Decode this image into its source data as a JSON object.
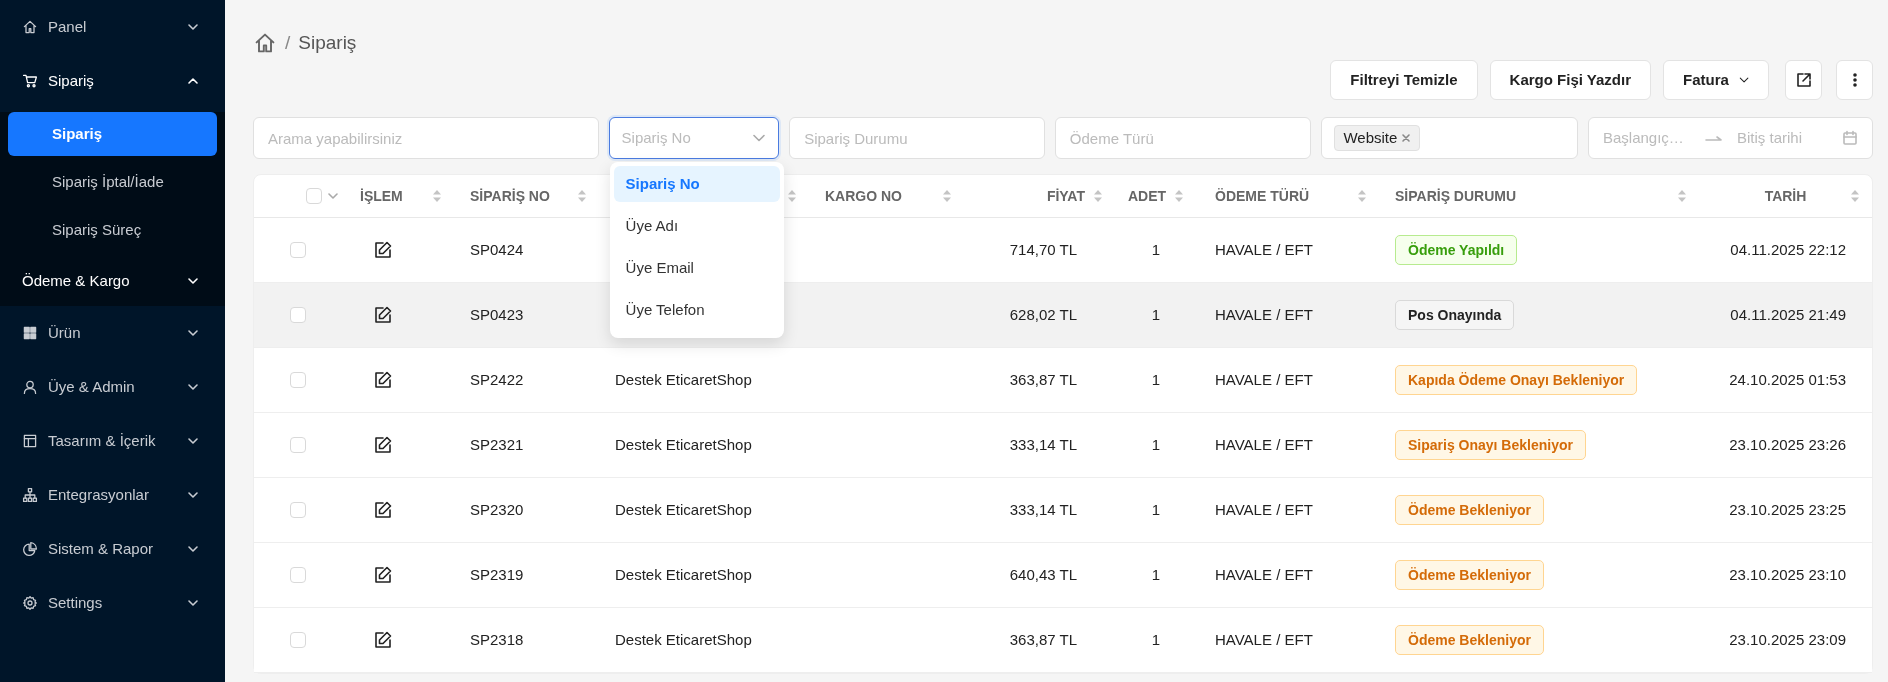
{
  "sidebar": {
    "items": [
      {
        "label": "Panel",
        "expanded": false,
        "selected": false
      },
      {
        "label": "Sipariş",
        "expanded": true,
        "selected": false,
        "children": [
          {
            "kind": "link",
            "label": "Sipariş",
            "selected": true
          },
          {
            "kind": "link",
            "label": "Sipariş İptal/İade",
            "selected": false
          },
          {
            "kind": "link",
            "label": "Sipariş Süreç",
            "selected": false
          },
          {
            "kind": "submenu",
            "label": "Ödeme & Kargo",
            "selected": false,
            "expanded": false
          }
        ]
      },
      {
        "label": "Ürün",
        "expanded": false,
        "selected": false
      },
      {
        "label": "Üye & Admin",
        "expanded": false,
        "selected": false
      },
      {
        "label": "Tasarım & İçerik",
        "expanded": false,
        "selected": false
      },
      {
        "label": "Entegrasyonlar",
        "expanded": false,
        "selected": false
      },
      {
        "label": "Sistem & Rapor",
        "expanded": false,
        "selected": false
      },
      {
        "label": "Settings",
        "expanded": false,
        "selected": false
      }
    ]
  },
  "breadcrumb": {
    "separator": "/",
    "current": "Sipariş"
  },
  "toolbar": {
    "buttons": [
      {
        "kind": "text",
        "label": "Filtreyi Temizle"
      },
      {
        "kind": "text",
        "label": "Kargo Fişi Yazdır"
      },
      {
        "kind": "dropdown",
        "label": "Fatura"
      },
      {
        "kind": "export"
      },
      {
        "kind": "more"
      }
    ]
  },
  "filters": {
    "search": {
      "placeholder": "Arama yapabilirsiniz"
    },
    "search_by": {
      "value": "Sipariş No",
      "open": true,
      "options": [
        {
          "label": "Sipariş No",
          "selected": true
        },
        {
          "label": "Üye Adı",
          "selected": false
        },
        {
          "label": "Üye Email",
          "selected": false
        },
        {
          "label": "Üye Telefon",
          "selected": false
        }
      ]
    },
    "order_status": {
      "placeholder": "Sipariş Durumu"
    },
    "payment_type": {
      "placeholder": "Ödeme Türü"
    },
    "channel": {
      "tags": [
        "Website"
      ]
    },
    "date_range": {
      "start_placeholder": "Başlangıç…",
      "end_placeholder": "Bitiş tarihi"
    }
  },
  "table": {
    "select_all": {
      "checked": false
    },
    "columns": [
      "İŞLEM",
      "SİPARİŞ NO",
      "",
      "KARGO NO",
      "FİYAT",
      "ADET",
      "ÖDEME TÜRÜ",
      "SİPARİŞ DURUMU",
      "TARİH"
    ],
    "rows": [
      {
        "checked": false,
        "highlighted": false,
        "order_no": "SP0424",
        "member": "",
        "cargo_no": "",
        "price": "714,70 TL",
        "quantity": "1",
        "payment": "HAVALE / EFT",
        "status": {
          "label": "Ödeme Yapıldı",
          "kind": "success"
        },
        "date": "04.11.2025 22:12"
      },
      {
        "checked": false,
        "highlighted": true,
        "order_no": "SP0423",
        "member": "",
        "cargo_no": "",
        "price": "628,02 TL",
        "quantity": "1",
        "payment": "HAVALE / EFT",
        "status": {
          "label": "Pos Onayında",
          "kind": "default"
        },
        "date": "04.11.2025 21:49"
      },
      {
        "checked": false,
        "highlighted": false,
        "order_no": "SP2422",
        "member": "Destek EticaretShop",
        "cargo_no": "",
        "price": "363,87 TL",
        "quantity": "1",
        "payment": "HAVALE / EFT",
        "status": {
          "label": "Kapıda Ödeme Onayı Bekleniyor",
          "kind": "warning"
        },
        "date": "24.10.2025 01:53"
      },
      {
        "checked": false,
        "highlighted": false,
        "order_no": "SP2321",
        "member": "Destek EticaretShop",
        "cargo_no": "",
        "price": "333,14 TL",
        "quantity": "1",
        "payment": "HAVALE / EFT",
        "status": {
          "label": "Sipariş Onayı Bekleniyor",
          "kind": "warning"
        },
        "date": "23.10.2025 23:26"
      },
      {
        "checked": false,
        "highlighted": false,
        "order_no": "SP2320",
        "member": "Destek EticaretShop",
        "cargo_no": "",
        "price": "333,14 TL",
        "quantity": "1",
        "payment": "HAVALE / EFT",
        "status": {
          "label": "Ödeme Bekleniyor",
          "kind": "warning"
        },
        "date": "23.10.2025 23:25"
      },
      {
        "checked": false,
        "highlighted": false,
        "order_no": "SP2319",
        "member": "Destek EticaretShop",
        "cargo_no": "",
        "price": "640,43 TL",
        "quantity": "1",
        "payment": "HAVALE / EFT",
        "status": {
          "label": "Ödeme Bekleniyor",
          "kind": "warning"
        },
        "date": "23.10.2025 23:10"
      },
      {
        "checked": false,
        "highlighted": false,
        "order_no": "SP2318",
        "member": "Destek EticaretShop",
        "cargo_no": "",
        "price": "363,87 TL",
        "quantity": "1",
        "payment": "HAVALE / EFT",
        "status": {
          "label": "Ödeme Bekleniyor",
          "kind": "warning"
        },
        "date": "23.10.2025 23:09"
      }
    ]
  }
}
